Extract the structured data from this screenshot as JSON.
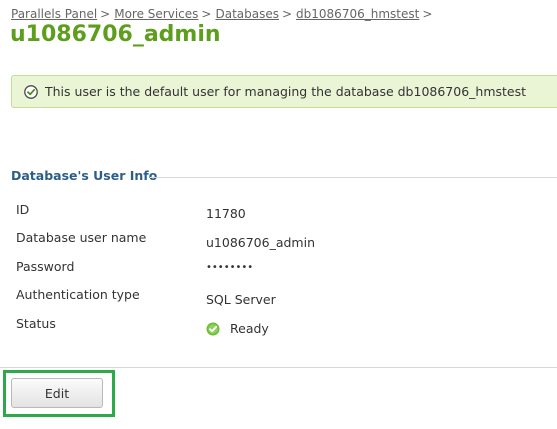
{
  "breadcrumb": {
    "items": [
      "Parallels Panel",
      "More Services",
      "Databases",
      "db1086706_hmstest"
    ],
    "separator": ">"
  },
  "page": {
    "title": "u1086706_admin"
  },
  "notice": {
    "icon": "check-circle-icon",
    "text": "This user is the default user for managing the database db1086706_hmstest"
  },
  "user_info": {
    "legend": "Database's User Info",
    "rows": [
      {
        "label": "ID",
        "value": "11780"
      },
      {
        "label": "Database user name",
        "value": "u1086706_admin"
      },
      {
        "label": "Password",
        "value": "••••••••"
      },
      {
        "label": "Authentication type",
        "value": "SQL Server"
      },
      {
        "label": "Status",
        "value": "Ready",
        "icon": "ready-check-icon"
      }
    ]
  },
  "actions": {
    "edit_label": "Edit"
  },
  "colors": {
    "title": "#5e9e1d",
    "notice_bg": "#eaf5d6",
    "notice_border": "#c3e092",
    "legend": "#2b5f8a",
    "highlight": "#2da94a"
  }
}
